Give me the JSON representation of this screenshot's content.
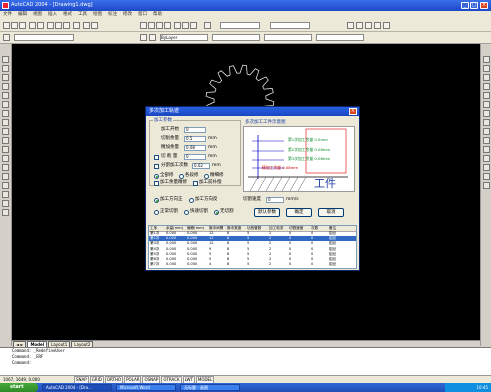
{
  "window": {
    "title": "AutoCAD 2004 - [Drawing1.dwg]"
  },
  "menubar": [
    "文件",
    "编辑",
    "视图",
    "插入",
    "格式",
    "工具",
    "绘图",
    "标注",
    "修改",
    "窗口",
    "帮助"
  ],
  "toolbar": {
    "layer_combo": "ByLayer"
  },
  "dialog": {
    "title": "多次加工轨迹",
    "params_group": "加工参数",
    "start_z_label": "加工开始",
    "start_z_value": "0",
    "cut_amount_label": "切削余量",
    "cut_amount_value": "0.5",
    "cut_amount_unit": "mm",
    "finish_amount_label": "精加余量",
    "finish_amount_value": "0.08",
    "finish_amount_unit": "mm",
    "depth_label": "切 削 量",
    "depth_value": "0",
    "depth_unit": "mm",
    "multi_label": "分割加工次数",
    "multi_value": "0.02",
    "multi_unit": "mm",
    "diagram_title": "多次加工工件示意图",
    "diagram_notes": [
      "第1次加工余量 0.5mm",
      "第2次加工余量 0.08mm",
      "第3次加工余量 0.08mm",
      "精加工余量 0.08mm"
    ],
    "workpiece_label": "工件",
    "opt_all": "全部修",
    "opt_each": "各段修",
    "opt_fine": "精细修",
    "opt_finish_only": "加工余量精修",
    "opt_compensate": "加工前补偿",
    "dir_forward": "加工方向正",
    "dir_reverse": "加工方向反",
    "speed_label": "切割速度",
    "speed_value": "0",
    "speed_unit": "mm/s",
    "mode_normal": "正常切割",
    "mode_fast": "快速切割",
    "mode_none": "无切割",
    "btn_default": "默认参数",
    "btn_ok": "确定",
    "btn_cancel": "取消",
    "table": {
      "headers": [
        "工序",
        "余量(mm)",
        "偏移(mm)",
        "脉冲间隔",
        "脉冲宽度",
        "功放管数",
        "加工电流",
        "切割速度",
        "次数",
        "备注"
      ],
      "rows": [
        [
          "第1次",
          "0.000",
          "0.000",
          "12",
          "8",
          "5",
          "2",
          "0",
          "0",
          "钼丝"
        ],
        [
          "第2次",
          "0.020",
          "0.000",
          "12",
          "8",
          "5",
          "2",
          "0",
          "0",
          "钼丝"
        ],
        [
          "第3次",
          "0.000",
          "0.000",
          "12",
          "8",
          "5",
          "2",
          "0",
          "0",
          "钼丝"
        ],
        [
          "第4次",
          "0.000",
          "0.000",
          "9",
          "8",
          "5",
          "2",
          "0",
          "0",
          "钼丝"
        ],
        [
          "第5次",
          "0.000",
          "0.000",
          "5",
          "8",
          "5",
          "2",
          "0",
          "0",
          "钼丝"
        ],
        [
          "第6次",
          "0.000",
          "0.000",
          "5",
          "8",
          "5",
          "2",
          "0",
          "0",
          "钼丝"
        ],
        [
          "第7次",
          "0.000",
          "0.000",
          "4",
          "8",
          "5",
          "2",
          "0",
          "0",
          "钼丝"
        ]
      ]
    }
  },
  "tabs": [
    "Model",
    "Layout1",
    "Layout2"
  ],
  "command": [
    "Command: _RedefineUser",
    "Command: _ERF",
    "Command:"
  ],
  "status": {
    "coords": "1067, 1649, 0.000",
    "buttons": [
      "SNAP",
      "GRID",
      "ORTHO",
      "POLAR",
      "OSNAP",
      "OTRACK",
      "LWT",
      "MODEL"
    ]
  },
  "taskbar": {
    "start": "start",
    "tasks": [
      "AutoCAD 2004 - [Dra...",
      "Microsoft Word",
      "无标题 - 画图"
    ],
    "clock": "10:45"
  }
}
